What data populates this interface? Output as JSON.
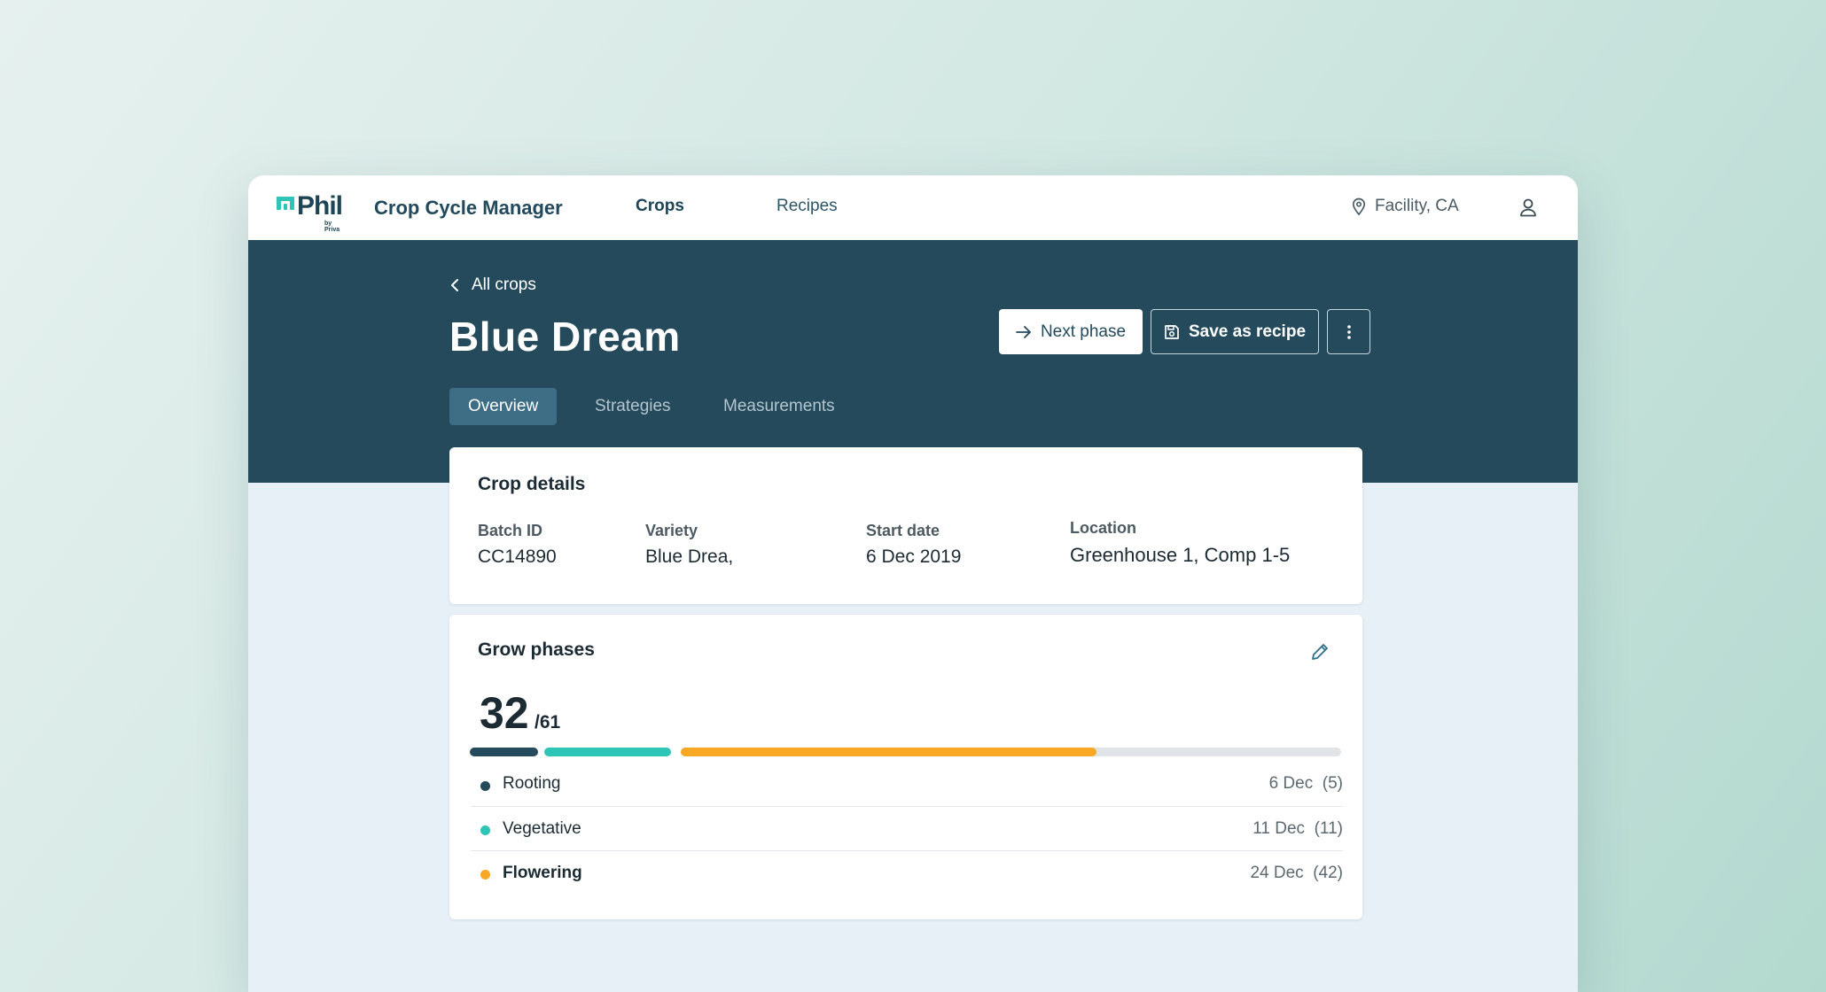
{
  "app": {
    "logo_text": "Phil",
    "logo_sub": "by Priva",
    "title": "Crop Cycle Manager"
  },
  "nav": {
    "items": [
      {
        "label": "Crops",
        "active": true
      },
      {
        "label": "Recipes",
        "active": false
      }
    ],
    "facility": "Facility, CA",
    "facility_icon": "location-pin-icon",
    "user_icon": "user-icon"
  },
  "header": {
    "back_label": "All crops",
    "crop_name": "Blue Dream",
    "actions": {
      "next_phase": "Next phase",
      "save_recipe": "Save as recipe",
      "more_icon": "more-vertical-icon"
    },
    "tabs": [
      {
        "label": "Overview",
        "active": true
      },
      {
        "label": "Strategies",
        "active": false
      },
      {
        "label": "Measurements",
        "active": false
      }
    ]
  },
  "crop_details": {
    "title": "Crop details",
    "fields": [
      {
        "label": "Batch ID",
        "value": "CC14890"
      },
      {
        "label": "Variety",
        "value": "Blue Drea,"
      },
      {
        "label": "Start date",
        "value": "6 Dec 2019"
      },
      {
        "label": "Location",
        "value": "Greenhouse 1, Comp 1-5"
      }
    ]
  },
  "grow_phases": {
    "title": "Grow phases",
    "current_day": "32",
    "total_days": "/61",
    "edit_icon": "pencil-icon",
    "colors": {
      "rooting": "#244a5c",
      "vegetative": "#2ec4b6",
      "flowering": "#f9a826",
      "track": "#e1e4e6"
    },
    "flowering_progress_fraction": 0.63,
    "phases": [
      {
        "name": "Rooting",
        "date": "6 Dec",
        "days": "(5)",
        "current": false
      },
      {
        "name": "Vegetative",
        "date": "11 Dec",
        "days": "(11)",
        "current": false
      },
      {
        "name": "Flowering",
        "date": "24 Dec",
        "days": "(42)",
        "current": true
      }
    ]
  }
}
